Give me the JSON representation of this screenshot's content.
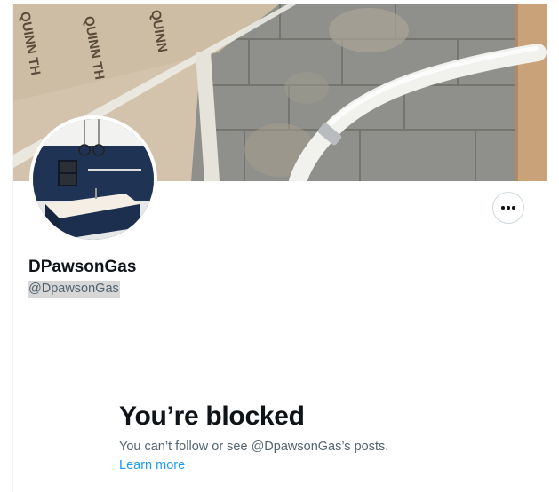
{
  "profile": {
    "display_name": "DPawsonGas",
    "handle": "@DpawsonGas",
    "banner_icon": "banner-image",
    "avatar_icon": "avatar-image",
    "more_icon": "more-icon"
  },
  "banner": {
    "board_text_1": "QUINN TH",
    "board_text_2": "QUINN TH",
    "board_text_3": "QUINN"
  },
  "blocked": {
    "title": "You’re blocked",
    "description": "You can’t follow or see @DpawsonGas’s posts.",
    "link": "Learn more"
  },
  "colors": {
    "link": "#1d9bf0",
    "text_primary": "#0f1419",
    "text_secondary": "#536471",
    "border": "#cfd9de"
  }
}
